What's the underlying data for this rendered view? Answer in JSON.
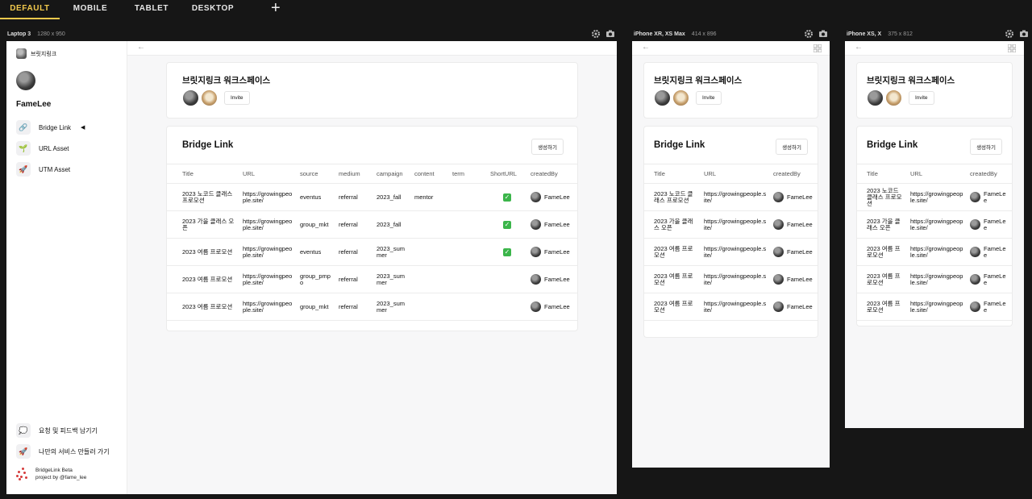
{
  "tabs": [
    "DEFAULT",
    "MOBILE",
    "TABLET",
    "DESKTOP"
  ],
  "devices": [
    {
      "name": "Laptop 3",
      "size": "1280 x 950"
    },
    {
      "name": "iPhone XR, XS Max",
      "size": "414 x 896"
    },
    {
      "name": "iPhone XS, X",
      "size": "375 x 812"
    }
  ],
  "sidebar": {
    "workspace": "브릿지링크",
    "user": "FameLee",
    "nav": [
      {
        "label": "Bridge Link",
        "icon": "🔗",
        "active": true
      },
      {
        "label": "URL Asset",
        "icon": "🌱"
      },
      {
        "label": "UTM Asset",
        "icon": "🚀"
      }
    ],
    "footer": [
      {
        "label": "요청 및 피드백 남기기",
        "icon": "💭"
      },
      {
        "label": "나만의 서비스 만들러 가기",
        "icon": "🚀"
      }
    ],
    "brand_line1": "BridgeLink Beta",
    "brand_line2": "project by @fame_lee"
  },
  "workspace": {
    "title": "브릿지링크 워크스페이스",
    "invite": "Invite"
  },
  "bridge": {
    "title": "Bridge Link",
    "create": "생성하기"
  },
  "columns_full": [
    "Title",
    "URL",
    "source",
    "medium",
    "campaign",
    "content",
    "term",
    "ShortURL",
    "createdBy"
  ],
  "columns_mobile": [
    "Title",
    "URL",
    "createdBy"
  ],
  "rows": [
    {
      "title": "2023 노코드 클래스 프로모션",
      "url": "https://growingpeople.site/",
      "source": "eventus",
      "medium": "referral",
      "campaign": "2023_fall",
      "content": "mentor",
      "term": "",
      "short": true,
      "by": "FameLee"
    },
    {
      "title": "2023 가을 클래스 오픈",
      "url": "https://growingpeople.site/",
      "source": "group_mkt",
      "medium": "referral",
      "campaign": "2023_fall",
      "content": "",
      "term": "",
      "short": true,
      "by": "FameLee"
    },
    {
      "title": "2023 여름 프로모션",
      "url": "https://growingpeople.site/",
      "source": "eventus",
      "medium": "referral",
      "campaign": "2023_summer",
      "content": "",
      "term": "",
      "short": true,
      "by": "FameLee"
    },
    {
      "title": "2023 여름 프로모션",
      "url": "https://growingpeople.site/",
      "source": "group_pmpo",
      "medium": "referral",
      "campaign": "2023_summer",
      "content": "",
      "term": "",
      "short": false,
      "by": "FameLee"
    },
    {
      "title": "2023 여름 프로모션",
      "url": "https://growingpeople.site/",
      "source": "group_mkt",
      "medium": "referral",
      "campaign": "2023_summer",
      "content": "",
      "term": "",
      "short": false,
      "by": "FameLee"
    }
  ],
  "check_icon": "✓",
  "colors": {
    "accent": "#f2c94c",
    "check": "#3bb54a",
    "bg": "#161616"
  }
}
